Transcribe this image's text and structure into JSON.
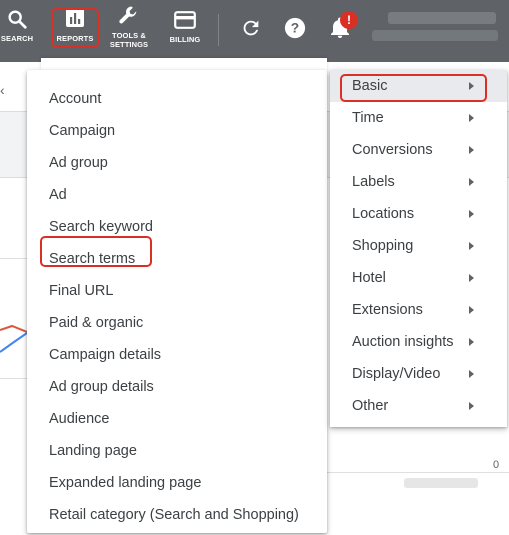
{
  "toolbar": {
    "search_label": "SEARCH",
    "reports_label": "REPORTS",
    "tools_label_line1": "TOOLS &",
    "tools_label_line2": "SETTINGS",
    "billing_label": "BILLING",
    "notification_count": "!",
    "icons": [
      "search-icon",
      "reports-icon",
      "wrench-icon",
      "billing-card-icon",
      "refresh-icon",
      "help-icon",
      "bell-icon"
    ]
  },
  "reports_menu": {
    "items": [
      "Account",
      "Campaign",
      "Ad group",
      "Ad",
      "Search keyword",
      "Search terms",
      "Final URL",
      "Paid & organic",
      "Campaign details",
      "Ad group details",
      "Audience",
      "Landing page",
      "Expanded landing page",
      "Retail category (Search and Shopping)"
    ]
  },
  "category_menu": {
    "items": [
      "Basic",
      "Time",
      "Conversions",
      "Labels",
      "Locations",
      "Shopping",
      "Hotel",
      "Extensions",
      "Auction insights",
      "Display/Video",
      "Other"
    ],
    "active": "Basic"
  },
  "background": {
    "axis_zero": "0"
  },
  "colors": {
    "toolbar_bg": "#5f6368",
    "highlight_red": "#d93025",
    "active_row": "#e8eaed",
    "text": "#3c4043"
  }
}
